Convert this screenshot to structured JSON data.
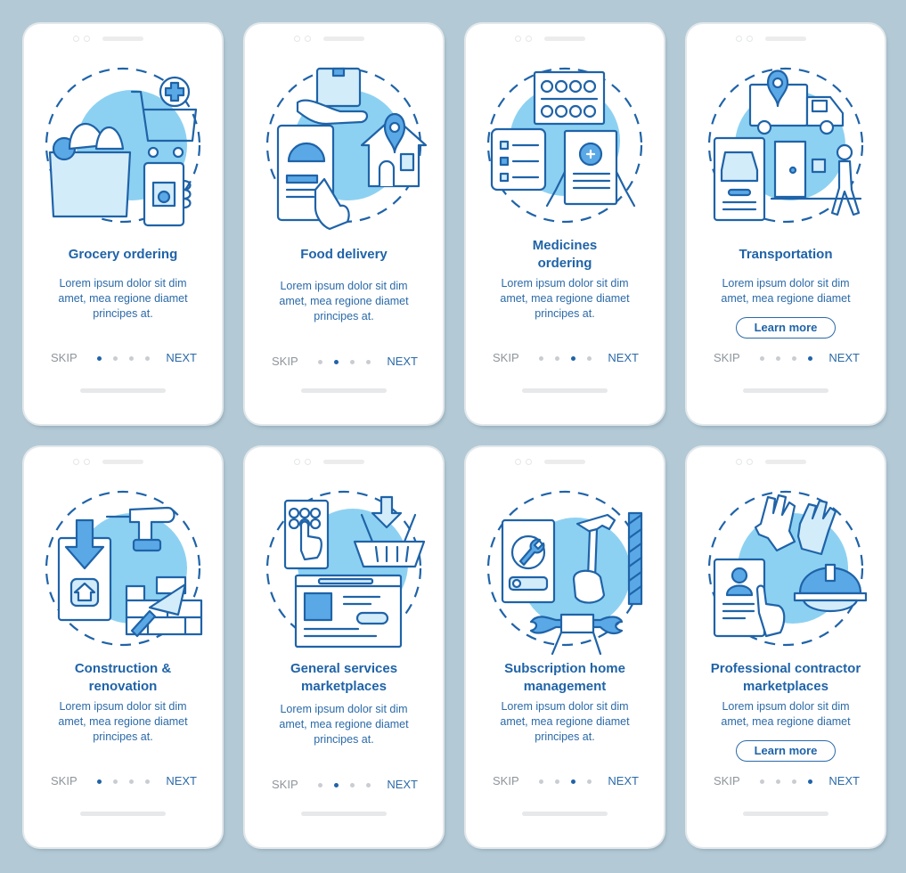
{
  "theme": {
    "accent": "#1f63a8",
    "illustration_fill": "#8dd1f2",
    "background": "#b3cad6",
    "inactive_dot": "#c9cdd1"
  },
  "screens": [
    {
      "title": "Grocery ordering",
      "title_lines": 1,
      "description": "Lorem ipsum dolor sit dim amet, mea regione diamet principes at.",
      "illustration": "grocery-ordering-icon",
      "skip": "SKIP",
      "next": "NEXT",
      "active_step": 1,
      "total_steps": 4
    },
    {
      "title": "Food delivery",
      "title_lines": 1,
      "description": "Lorem ipsum dolor sit dim amet, mea regione diamet principes at.",
      "illustration": "food-delivery-icon",
      "skip": "SKIP",
      "next": "NEXT",
      "active_step": 2,
      "total_steps": 4
    },
    {
      "title": "Medicines ordering",
      "title_lines": 2,
      "description": "Lorem ipsum dolor sit dim amet, mea regione diamet principes at.",
      "illustration": "medicines-ordering-icon",
      "skip": "SKIP",
      "next": "NEXT",
      "active_step": 3,
      "total_steps": 4
    },
    {
      "title": "Transportation",
      "title_lines": 1,
      "description": "Lorem ipsum dolor sit dim amet, mea regione diamet",
      "illustration": "transportation-icon",
      "button": "Learn more",
      "skip": "SKIP",
      "next": "NEXT",
      "active_step": 4,
      "total_steps": 4
    },
    {
      "title": "Construction & renovation",
      "title_lines": 2,
      "description": "Lorem ipsum dolor sit dim amet, mea regione diamet principes at.",
      "illustration": "construction-renovation-icon",
      "skip": "SKIP",
      "next": "NEXT",
      "active_step": 1,
      "total_steps": 4
    },
    {
      "title": "General services marketplaces",
      "title_lines": 2,
      "description": "Lorem ipsum dolor sit dim amet, mea regione diamet principes at.",
      "illustration": "general-services-icon",
      "skip": "SKIP",
      "next": "NEXT",
      "active_step": 2,
      "total_steps": 4
    },
    {
      "title": "Subscription home management",
      "title_lines": 2,
      "description": "Lorem ipsum dolor sit dim amet, mea regione diamet principes at.",
      "illustration": "home-management-icon",
      "skip": "SKIP",
      "next": "NEXT",
      "active_step": 3,
      "total_steps": 4
    },
    {
      "title": "Professional contractor marketplaces",
      "title_lines": 2,
      "description": "Lorem ipsum dolor sit dim amet, mea regione diamet",
      "illustration": "contractor-marketplace-icon",
      "button": "Learn more",
      "skip": "SKIP",
      "next": "NEXT",
      "active_step": 4,
      "total_steps": 4
    }
  ]
}
